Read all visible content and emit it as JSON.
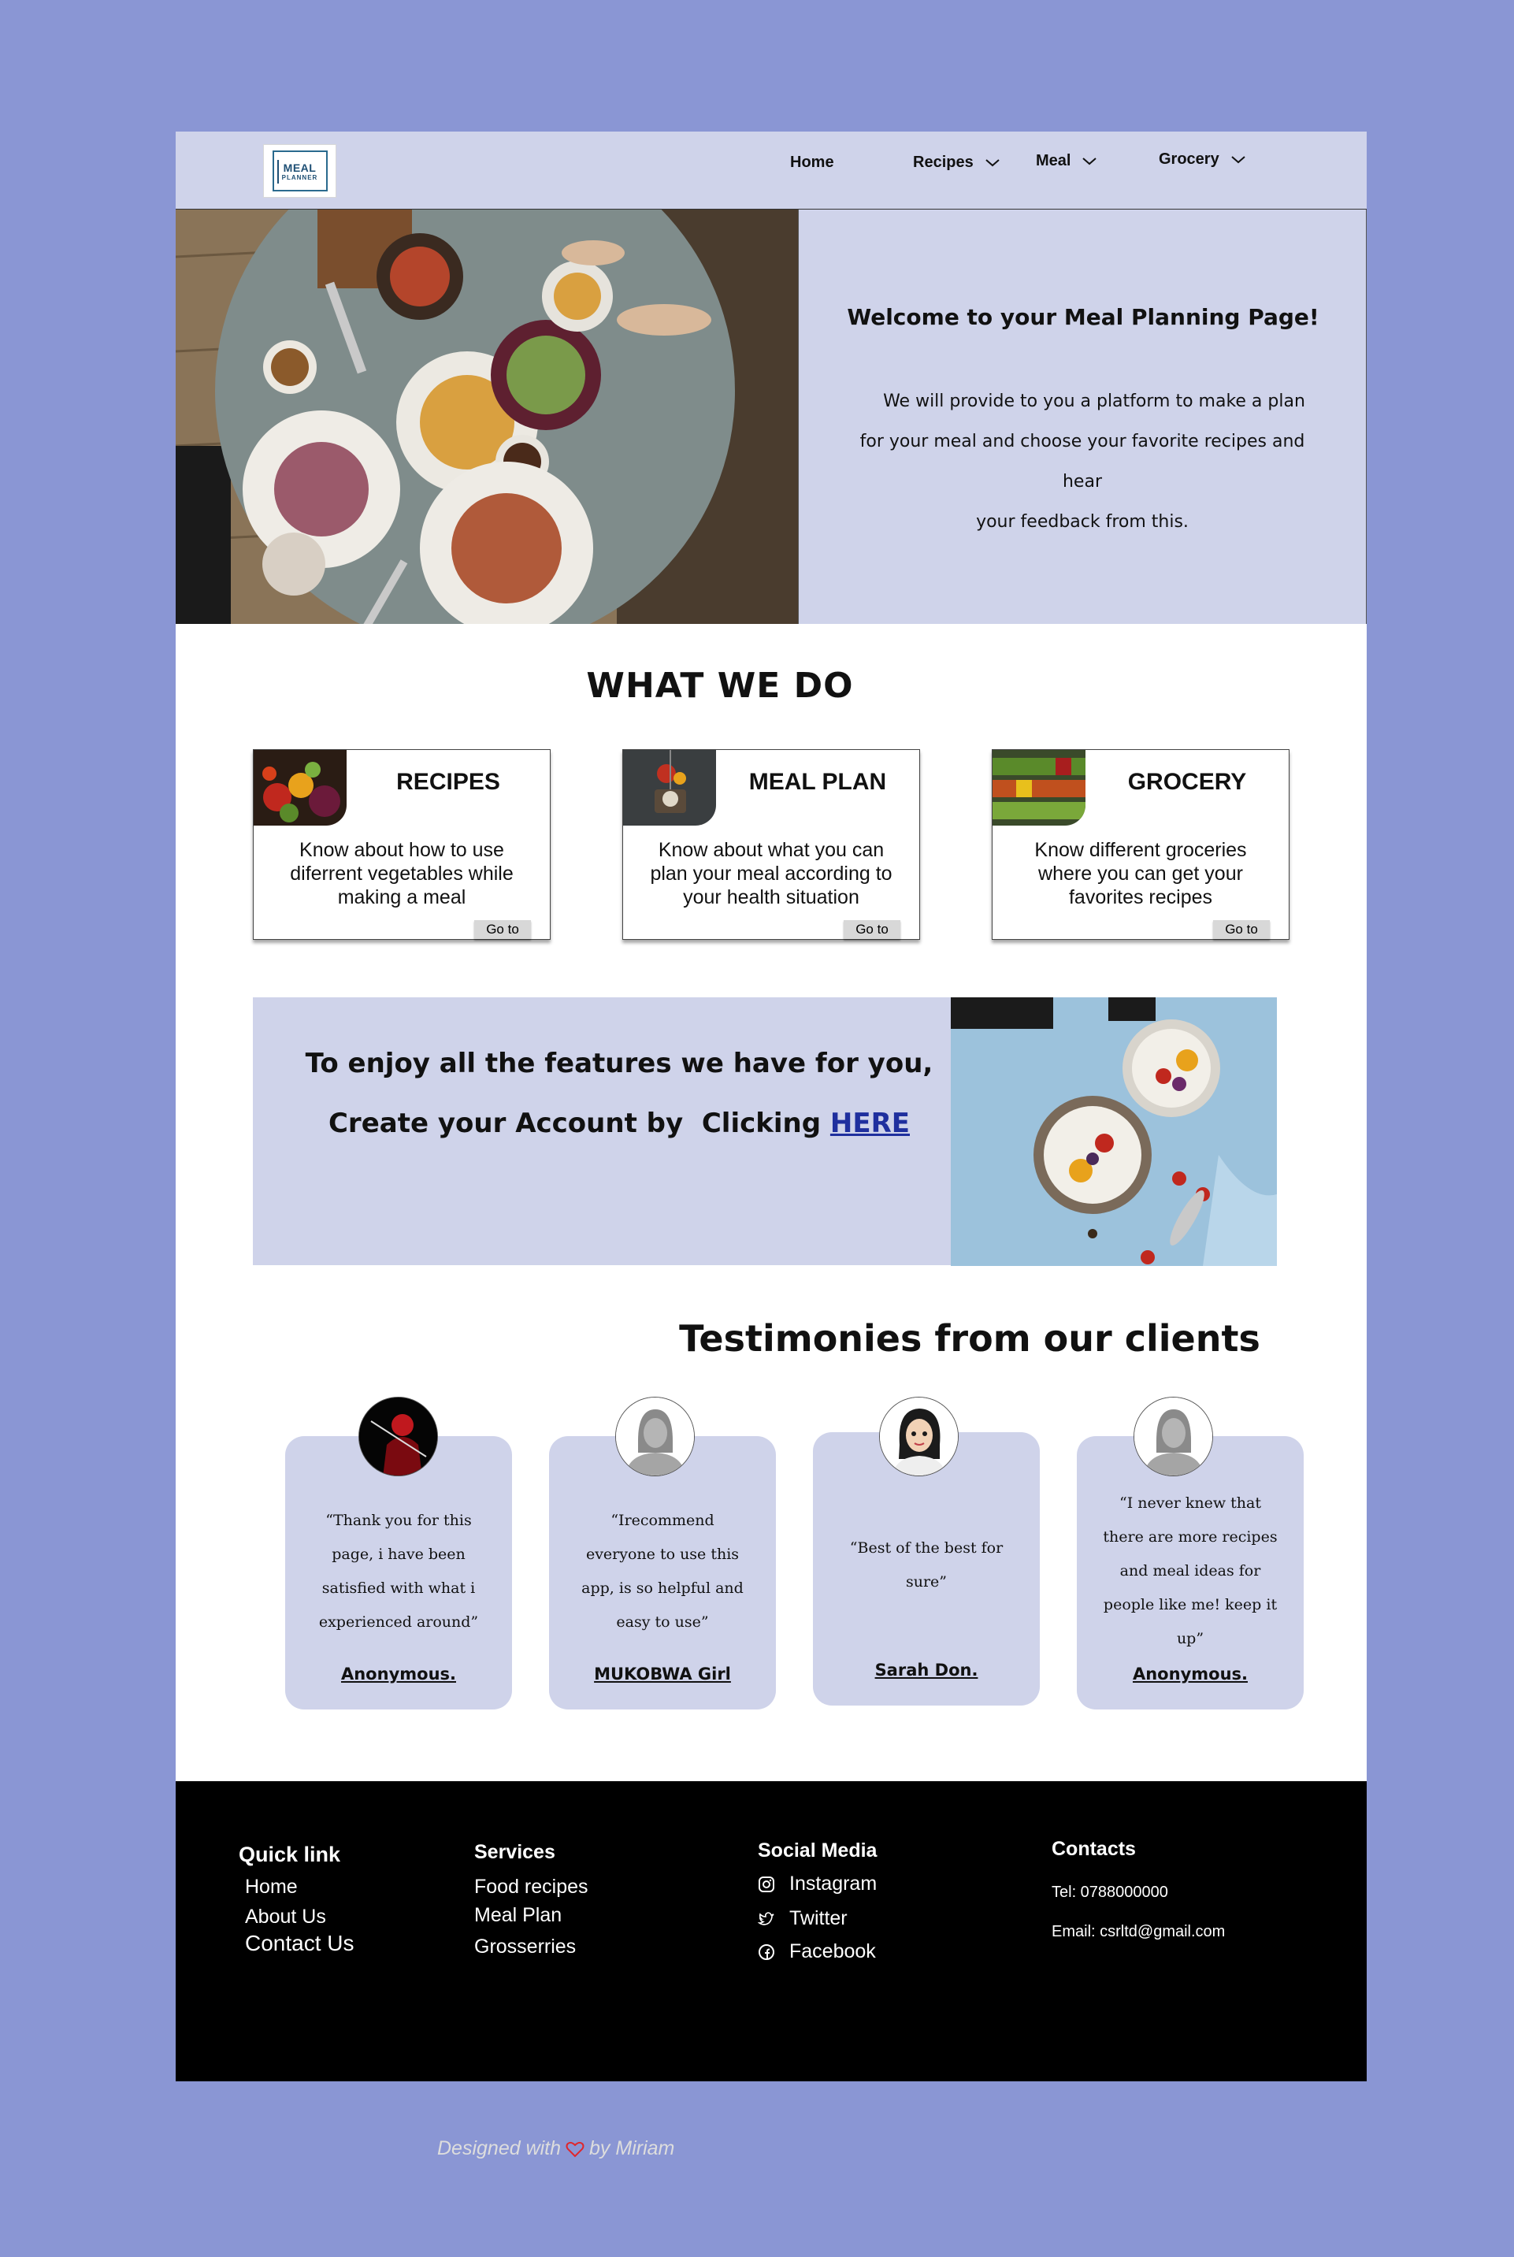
{
  "nav": {
    "logo_line1": "MEAL",
    "logo_line2": "PLANNER",
    "items": [
      {
        "label": "Home"
      },
      {
        "label": "Recipes"
      },
      {
        "label": "Meal"
      },
      {
        "label": "Grocery"
      }
    ]
  },
  "hero": {
    "title": "Welcome to your Meal Planning Page!",
    "text_line1": "We will provide to you a platform to make a plan",
    "text_line2": "for your meal and choose your favorite recipes and hear",
    "text_line3": "your feedback from this."
  },
  "what_we_do": {
    "title": "WHAT WE DO",
    "cards": [
      {
        "title": "RECIPES",
        "text": "Know about how to use diferrent vegetables while making a meal",
        "button": "Go to"
      },
      {
        "title": "MEAL PLAN",
        "text": "Know about what you can plan your meal according to your health situation",
        "button": "Go to"
      },
      {
        "title": "GROCERY",
        "text": "Know different groceries where you can get your favorites recipes",
        "button": "Go to"
      }
    ]
  },
  "cta": {
    "line1": "To enjoy all the features we have for you,",
    "line2_prefix": "Create your Account by  Clicking ",
    "link": "HERE"
  },
  "testimonies": {
    "title": "Testimonies from our clients",
    "items": [
      {
        "quote_lines": [
          "“Thank you for this",
          "page, i have been",
          "satisfied with what i",
          "experienced around”"
        ],
        "name": "Anonymous."
      },
      {
        "quote_lines": [
          "“Irecommend",
          "everyone to use this",
          "app, is so helpful and",
          "easy to use”"
        ],
        "name": "MUKOBWA Girl"
      },
      {
        "quote_lines": [
          "“Best of the best for",
          "sure”"
        ],
        "name": "Sarah Don."
      },
      {
        "quote_lines": [
          "“I never knew that",
          "there are more recipes",
          "and meal ideas for",
          "people like me! keep it",
          "up”"
        ],
        "name": "Anonymous."
      }
    ]
  },
  "footer": {
    "quick_link": {
      "heading": "Quick link",
      "links": [
        "Home",
        "About Us",
        "Contact Us"
      ]
    },
    "services": {
      "heading": "Services",
      "links": [
        "Food recipes",
        "Meal Plan",
        "Grosserries"
      ]
    },
    "social": {
      "heading": "Social Media",
      "links": [
        "Instagram",
        "Twitter",
        "Facebook"
      ]
    },
    "contacts": {
      "heading": "Contacts",
      "tel": "Tel: 0788000000",
      "email": "Email: csrltd@gmail.com"
    },
    "designed_prefix": "Designed with",
    "designed_suffix": "by Miriam"
  },
  "colors": {
    "background": "#8a96d4",
    "panel": "#cfd3ea",
    "link": "#1f2f9e",
    "footer": "#000000",
    "heart": "#e0262b"
  },
  "icons": [
    "chevron-down-icon",
    "instagram-icon",
    "twitter-icon",
    "facebook-icon",
    "heart-icon"
  ]
}
